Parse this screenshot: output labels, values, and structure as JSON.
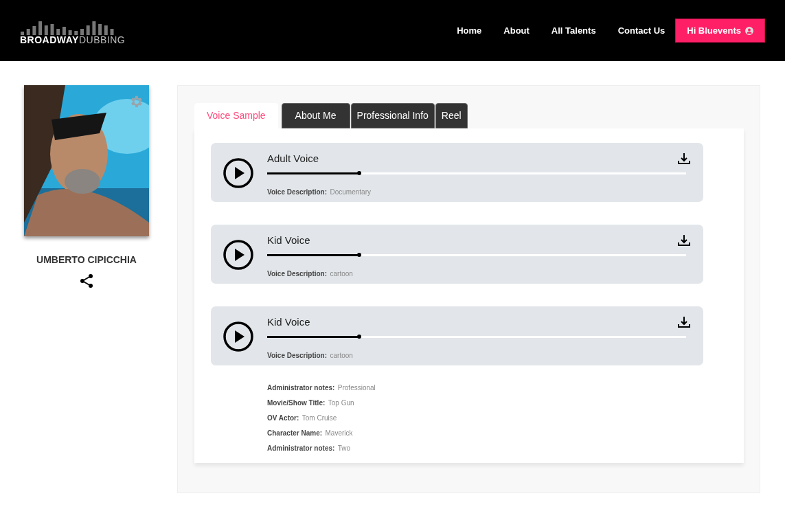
{
  "logo": {
    "part_1": "BROADWAY",
    "part_2": "DUBBING"
  },
  "nav": {
    "links": [
      {
        "label": "Home"
      },
      {
        "label": "About"
      },
      {
        "label": "All Talents"
      },
      {
        "label": "Contact Us"
      }
    ],
    "user_button": "Hi Bluevents"
  },
  "profile": {
    "name": "UMBERTO CIPICCHIA"
  },
  "tabs": [
    {
      "label": "Voice Sample",
      "selected": true
    },
    {
      "label": "About Me",
      "selected": false
    },
    {
      "label": "Professional Info",
      "selected": false
    },
    {
      "label": "Reel",
      "selected": false
    }
  ],
  "samples": [
    {
      "title": "Adult Voice",
      "level": 0.22,
      "desc_label": "Voice Description:",
      "desc_value": "Documentary"
    },
    {
      "title": "Kid Voice",
      "level": 0.22,
      "desc_label": "Voice Description:",
      "desc_value": "cartoon"
    },
    {
      "title": "Kid Voice",
      "level": 0.22,
      "desc_label": "Voice Description:",
      "desc_value": "cartoon"
    }
  ],
  "notes": [
    {
      "label": "Administrator notes:",
      "value": "Professional"
    },
    {
      "label": "Movie/Show Title:",
      "value": "Top Gun"
    },
    {
      "label": "OV Actor:",
      "value": "Tom Cruise"
    },
    {
      "label": "Character Name:",
      "value": "Maverick"
    },
    {
      "label": "Administrator notes:",
      "value": "Two"
    }
  ]
}
